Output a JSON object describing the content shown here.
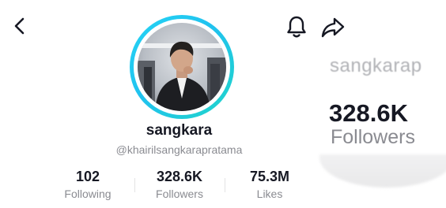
{
  "header": {
    "back_icon": "chevron-left-icon",
    "notification_icon": "bell-icon",
    "share_icon": "share-arrow-icon"
  },
  "profile": {
    "username": "sangkara",
    "handle": "@khairilsangkarapratama",
    "ring_colors": [
      "#25d4f4",
      "#20d5c8"
    ]
  },
  "stats": [
    {
      "value": "102",
      "label": "Following"
    },
    {
      "value": "328.6K",
      "label": "Followers"
    },
    {
      "value": "75.3M",
      "label": "Likes"
    }
  ],
  "side_panel": {
    "name_fragment": "sangkarap",
    "followers_value": "328.6K",
    "followers_label": "Followers"
  }
}
